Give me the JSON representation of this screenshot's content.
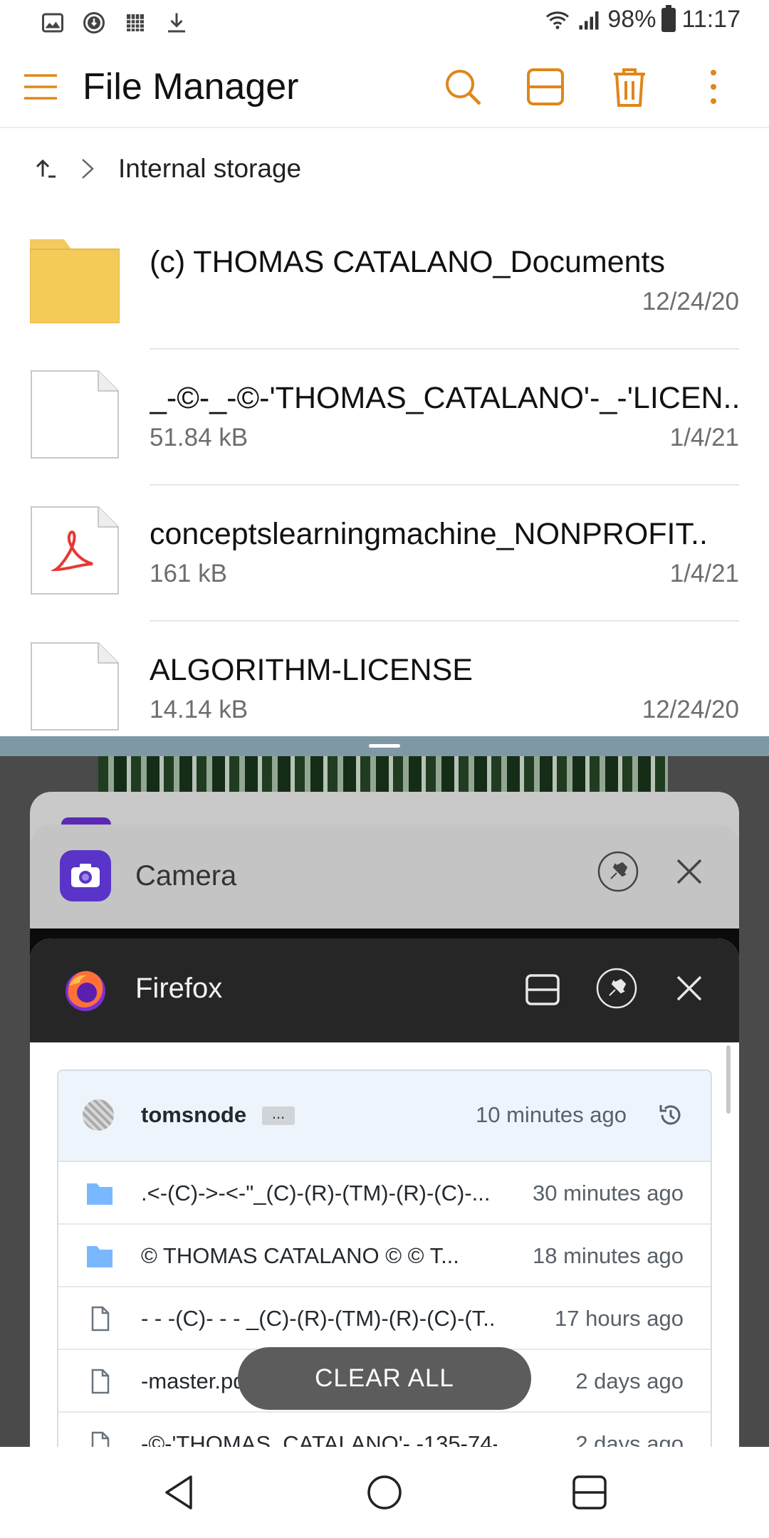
{
  "status_bar": {
    "left_icons": [
      "gallery-icon",
      "download-progress-icon",
      "calendar-icon",
      "download-icon"
    ],
    "battery": "98%",
    "time": "11:17"
  },
  "app_bar": {
    "title": "File Manager",
    "actions": [
      "search-icon",
      "split-view-icon",
      "delete-icon",
      "more-vert-icon"
    ],
    "accent_color": "#E0861A"
  },
  "breadcrumb": {
    "path": "Internal storage"
  },
  "files": [
    {
      "type": "folder",
      "name": "(c) THOMAS CATALANO_Documents",
      "size": "",
      "date": "12/24/20"
    },
    {
      "type": "file",
      "name": "_-©-_-©-'THOMAS_CATALANO'-_-'LICEN..",
      "size": "51.84 kB",
      "date": "1/4/21"
    },
    {
      "type": "pdf",
      "name": "conceptslearningmachine_NONPROFIT..",
      "size": "161 kB",
      "date": "1/4/21"
    },
    {
      "type": "file",
      "name": "ALGORITHM-LICENSE",
      "size": "14.14 kB",
      "date": "12/24/20"
    }
  ],
  "recents": {
    "camera_card": {
      "label": "Camera"
    },
    "firefox_card": {
      "label": "Firefox",
      "repo": {
        "user": "tomsnode",
        "dots": "...",
        "ago": "10 minutes ago",
        "items": [
          {
            "type": "folder",
            "name": ".<-(C)->-<-\"_(C)-(R)-(TM)-(R)-(C)-...",
            "time": "30 minutes ago"
          },
          {
            "type": "folder",
            "name": "© THOMAS CATALANO © © T...",
            "time": "18 minutes ago"
          },
          {
            "type": "file",
            "name": "- - -(C)- - - _(C)-(R)-(TM)-(R)-(C)-(T...",
            "time": "17 hours ago"
          },
          {
            "type": "file",
            "name": "-master.pdf",
            "time": "2 days ago"
          },
          {
            "type": "file",
            "name": "-©-'THOMAS_CATALANO'- -135-74-",
            "time": "2 days ago"
          }
        ]
      }
    },
    "clear_all": "CLEAR ALL"
  },
  "nav_bar": [
    "back-icon",
    "home-icon",
    "recents-icon"
  ]
}
